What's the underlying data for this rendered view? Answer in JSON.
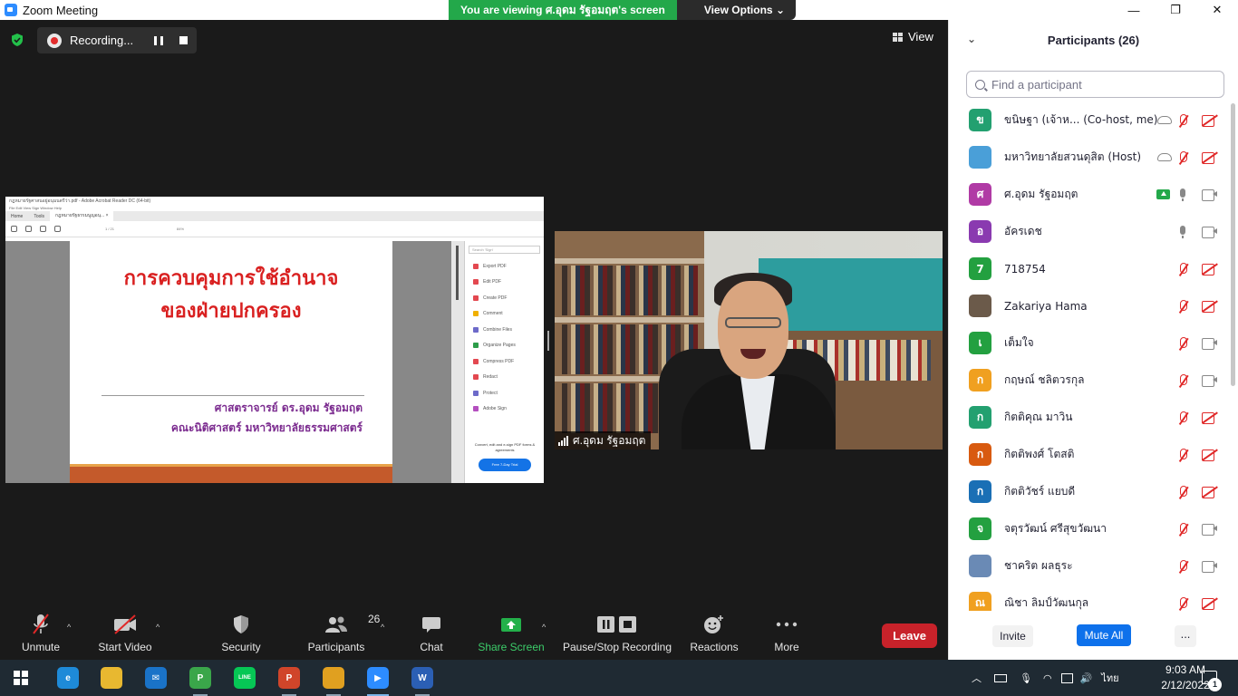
{
  "window": {
    "title": "Zoom Meeting",
    "controls": {
      "minimize": "—",
      "restore": "❐",
      "close": "✕"
    }
  },
  "banner": {
    "prefix": "You are viewing ",
    "presenter": "ศ.อุดม รัฐอมฤต",
    "suffix": "'s screen",
    "options_label": "View Options ⌄"
  },
  "recording": {
    "label": "Recording..."
  },
  "view_button": {
    "label": "View"
  },
  "shared_screen": {
    "acrobat": {
      "window_title": "กฎหมายรัฐศาสนอยู่อนุมนตรีว่า.pdf - Adobe Acrobat Reader DC (64-bit)",
      "menu": "File   Edit   View   Sign   Window   Help",
      "tab_home": "Home",
      "tab_tools": "Tools",
      "tab_doc": "กฎหมายรัฐธรรมนูญอนุ...  ×",
      "page_info": "1  / 21",
      "zoom": "84%",
      "search_placeholder": "Search 'Sign'",
      "tools": [
        {
          "label": "Export PDF",
          "color": "#e34850"
        },
        {
          "label": "Edit PDF",
          "color": "#e34850"
        },
        {
          "label": "Create PDF",
          "color": "#e34850"
        },
        {
          "label": "Comment",
          "color": "#f0b000"
        },
        {
          "label": "Combine Files",
          "color": "#6d6ac9"
        },
        {
          "label": "Organize Pages",
          "color": "#2d9d4a"
        },
        {
          "label": "Compress PDF",
          "color": "#e34850"
        },
        {
          "label": "Redact",
          "color": "#e34850"
        },
        {
          "label": "Protect",
          "color": "#6d6ac9"
        },
        {
          "label": "Adobe Sign",
          "color": "#b44fbf"
        }
      ],
      "promo": "Convert, edit and e-sign PDF forms & agreements",
      "trial_button": "Free 7-Day Trial"
    },
    "slide": {
      "title_line1": "การควบคุมการใช้อำนาจ",
      "title_line2": "ของฝ่ายปกครอง",
      "author": "ศาสตราจารย์ ดร.อุดม รัฐอมฤต",
      "affiliation": "คณะนิติศาสตร์ มหาวิทยาลัยธรรมศาสตร์"
    }
  },
  "video": {
    "participant_name": "ศ.อุดม รัฐอมฤต"
  },
  "toolbar": {
    "unmute": "Unmute",
    "start_video": "Start Video",
    "security": "Security",
    "participants": "Participants",
    "participants_count": "26",
    "chat": "Chat",
    "share_screen": "Share Screen",
    "pause_stop_recording": "Pause/Stop Recording",
    "reactions": "Reactions",
    "more": "More",
    "leave": "Leave",
    "caret": "^"
  },
  "panel": {
    "title": "Participants (26)",
    "search_placeholder": "Find a participant",
    "invite": "Invite",
    "mute_all": "Mute All",
    "more": "...",
    "participants": [
      {
        "initial": "ข",
        "name": "ขนิษฐา (เจ้าห...    (Co-host, me)",
        "color": "#23a070",
        "mic": "off",
        "cam": "off",
        "extra": "cloud"
      },
      {
        "initial": "",
        "name": "มหาวิทยาลัยสวนดุสิต (Host)",
        "color": "#4a9fd8",
        "mic": "off",
        "cam": "off",
        "extra": "cloud"
      },
      {
        "initial": "ศ",
        "name": "ศ.อุดม รัฐอมฤต",
        "color": "#b03aa5",
        "mic": "on",
        "cam": "on",
        "extra": "share"
      },
      {
        "initial": "อ",
        "name": "อัครเดช",
        "color": "#8a3ab0",
        "mic": "on",
        "cam": "on",
        "extra": ""
      },
      {
        "initial": "7",
        "name": "718754",
        "color": "#23a040",
        "mic": "off",
        "cam": "off",
        "extra": ""
      },
      {
        "initial": "",
        "name": "Zakariya Hama",
        "color": "#6b5a4a",
        "mic": "off",
        "cam": "off",
        "extra": ""
      },
      {
        "initial": "เ",
        "name": "เต็มใจ",
        "color": "#23a040",
        "mic": "off",
        "cam": "on",
        "extra": ""
      },
      {
        "initial": "ก",
        "name": "กฤษณ์ ชลิตวรกุล",
        "color": "#f0a020",
        "mic": "off",
        "cam": "on",
        "extra": ""
      },
      {
        "initial": "ก",
        "name": "กิตติคุณ  มาวิน",
        "color": "#23a070",
        "mic": "off",
        "cam": "off",
        "extra": ""
      },
      {
        "initial": "ก",
        "name": "กิตติพงศ์  โตสติ",
        "color": "#d85a10",
        "mic": "off",
        "cam": "off",
        "extra": ""
      },
      {
        "initial": "ก",
        "name": "กิตติวัชร์ แยบดี",
        "color": "#1a6fb5",
        "mic": "off",
        "cam": "off",
        "extra": ""
      },
      {
        "initial": "จ",
        "name": "จตุรวัฒน์ ศรีสุขวัฒนา",
        "color": "#23a040",
        "mic": "off",
        "cam": "on",
        "extra": ""
      },
      {
        "initial": "",
        "name": "ชาคริต ผลธุระ",
        "color": "#6a8ab5",
        "mic": "off",
        "cam": "on",
        "extra": ""
      },
      {
        "initial": "ณ",
        "name": "ณิชา ลิมป์วัฒนกุล",
        "color": "#f0a020",
        "mic": "off",
        "cam": "off",
        "extra": ""
      }
    ]
  },
  "taskbar": {
    "apps": [
      {
        "name": "edge",
        "glyph": "e",
        "color": "#1e8ad8",
        "state": ""
      },
      {
        "name": "file-explorer",
        "glyph": "",
        "color": "#e8b830",
        "state": ""
      },
      {
        "name": "mail",
        "glyph": "✉",
        "color": "#1a73c8",
        "state": ""
      },
      {
        "name": "chrome-profile",
        "glyph": "P",
        "color": "#3aa64a",
        "state": "open"
      },
      {
        "name": "line",
        "glyph": "LINE",
        "color": "#06c755",
        "state": ""
      },
      {
        "name": "powerpoint",
        "glyph": "P",
        "color": "#d0452a",
        "state": "open"
      },
      {
        "name": "chrome",
        "glyph": "",
        "color": "#e0a020",
        "state": "open"
      },
      {
        "name": "zoom",
        "glyph": "▶",
        "color": "#2d8cff",
        "state": "active"
      },
      {
        "name": "word",
        "glyph": "W",
        "color": "#2b5fb4",
        "state": "open"
      }
    ],
    "language": "ไทย",
    "time": "9:03 AM",
    "date": "2/12/2022",
    "notifications": "1"
  }
}
